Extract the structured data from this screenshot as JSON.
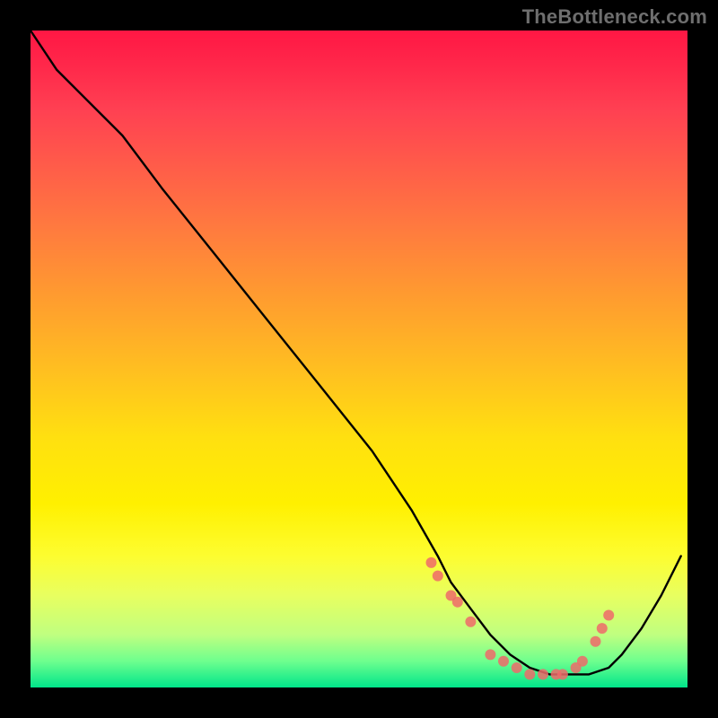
{
  "watermark": "TheBottleneck.com",
  "chart_data": {
    "type": "line",
    "title": "",
    "xlabel": "",
    "ylabel": "",
    "xlim": [
      0,
      100
    ],
    "ylim": [
      0,
      100
    ],
    "grid": false,
    "legend": false,
    "series": [
      {
        "name": "curve",
        "x": [
          0,
          4,
          8,
          14,
          20,
          28,
          36,
          44,
          52,
          58,
          62,
          64,
          67,
          70,
          73,
          76,
          79,
          82,
          85,
          88,
          90,
          93,
          96,
          99
        ],
        "y": [
          100,
          94,
          90,
          84,
          76,
          66,
          56,
          46,
          36,
          27,
          20,
          16,
          12,
          8,
          5,
          3,
          2,
          2,
          2,
          3,
          5,
          9,
          14,
          20
        ]
      }
    ],
    "markers": [
      {
        "name": "dots-band",
        "color": "#ef6a6a",
        "radius": 6,
        "x": [
          61,
          62,
          64,
          65,
          67,
          70,
          72,
          74,
          76,
          78,
          80,
          81,
          83,
          84,
          86,
          87,
          88
        ],
        "y": [
          19,
          17,
          14,
          13,
          10,
          5,
          4,
          3,
          2,
          2,
          2,
          2,
          3,
          4,
          7,
          9,
          11
        ]
      }
    ]
  }
}
